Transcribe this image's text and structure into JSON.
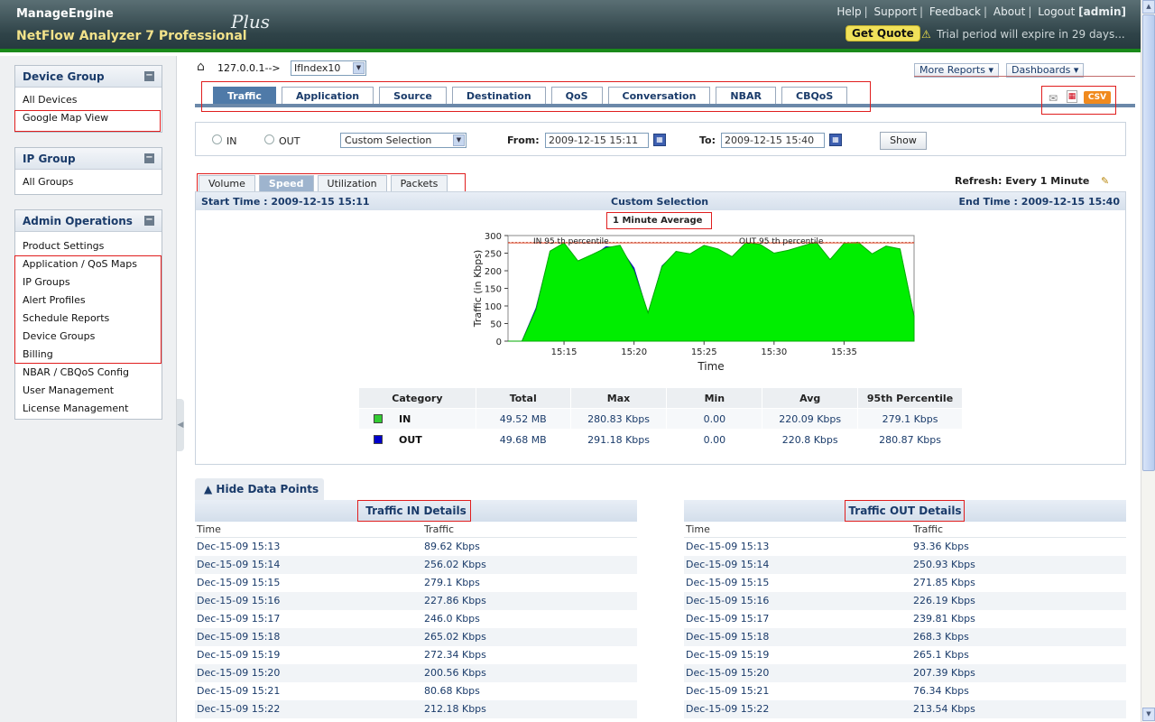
{
  "header": {
    "brand": "ManageEngine",
    "product": "NetFlow Analyzer 7 Professional",
    "edition": "Plus",
    "links": [
      "Help",
      "Support",
      "Feedback",
      "About",
      "Logout"
    ],
    "user": "[admin]",
    "get_quote": "Get Quote",
    "trial_text": "Trial period will expire in 29 days..."
  },
  "sidebar": {
    "device_group": {
      "title": "Device Group",
      "items": [
        "All Devices",
        "Google Map View"
      ]
    },
    "ip_group": {
      "title": "IP Group",
      "items": [
        "All Groups"
      ]
    },
    "admin": {
      "title": "Admin Operations",
      "items": [
        "Product Settings",
        "Application / QoS Maps",
        "IP Groups",
        "Alert Profiles",
        "Schedule Reports",
        "Device Groups",
        "Billing",
        "NBAR / CBQoS Config",
        "User Management",
        "License Management"
      ]
    }
  },
  "breadcrumb": {
    "device": "127.0.0.1-->",
    "interface": "IfIndex10"
  },
  "top_buttons": {
    "more_reports": "More Reports",
    "dashboards": "Dashboards"
  },
  "tabs": [
    "Traffic",
    "Application",
    "Source",
    "Destination",
    "QoS",
    "Conversation",
    "NBAR",
    "CBQoS"
  ],
  "active_tab": "Traffic",
  "filter": {
    "in_label": "IN",
    "out_label": "OUT",
    "range": "Custom Selection",
    "from_label": "From:",
    "from_value": "2009-12-15 15:11",
    "to_label": "To:",
    "to_value": "2009-12-15 15:40",
    "show": "Show"
  },
  "sub_tabs": [
    "Volume",
    "Speed",
    "Utilization",
    "Packets"
  ],
  "active_sub_tab": "Speed",
  "refresh": "Refresh: Every 1 Minute",
  "chart_header": {
    "start": "Start Time : 2009-12-15 15:11",
    "title": "Custom Selection",
    "end": "End Time : 2009-12-15 15:40",
    "average": "1 Minute Average"
  },
  "chart_data": {
    "type": "area",
    "xlabel": "Time",
    "ylabel": "Traffic (in Kbps)",
    "ylim": [
      0,
      300
    ],
    "yticks": [
      0,
      50,
      100,
      150,
      200,
      250,
      300
    ],
    "xticks": [
      "15:15",
      "15:20",
      "15:25",
      "15:30",
      "15:35"
    ],
    "annotations": [
      "IN 95 th percentile",
      "OUT 95 th percentile"
    ],
    "percentile_in": 279.1,
    "percentile_out": 280.87,
    "x": [
      "15:11",
      "15:12",
      "15:13",
      "15:14",
      "15:15",
      "15:16",
      "15:17",
      "15:18",
      "15:19",
      "15:20",
      "15:21",
      "15:22",
      "15:23",
      "15:24",
      "15:25",
      "15:26",
      "15:27",
      "15:28",
      "15:29",
      "15:30",
      "15:31",
      "15:32",
      "15:33",
      "15:34",
      "15:35",
      "15:36",
      "15:37",
      "15:38",
      "15:39",
      "15:40"
    ],
    "series": [
      {
        "name": "IN",
        "color": "#00ee00",
        "values": [
          0,
          0,
          89.62,
          256.02,
          279.1,
          227.86,
          246.0,
          265.02,
          272.34,
          200.56,
          80.68,
          212.18,
          255,
          248,
          272,
          262,
          240,
          280,
          275,
          250,
          258,
          270,
          282,
          232,
          278,
          281,
          248,
          270,
          262,
          70
        ]
      },
      {
        "name": "OUT",
        "color": "#0000cc",
        "values": [
          0,
          0,
          93.36,
          250.93,
          271.85,
          226.19,
          239.81,
          268.3,
          265.1,
          207.39,
          76.34,
          213.54,
          252,
          245,
          270,
          258,
          236,
          278,
          270,
          246,
          255,
          268,
          280,
          230,
          276,
          279,
          245,
          268,
          258,
          68
        ]
      }
    ]
  },
  "stats": {
    "headers": [
      "Category",
      "Total",
      "Max",
      "Min",
      "Avg",
      "95th Percentile"
    ],
    "rows": [
      {
        "category": "IN",
        "color": "#33cc33",
        "total": "49.52 MB",
        "max": "280.83 Kbps",
        "min": "0.00",
        "avg": "220.09 Kbps",
        "p95": "279.1 Kbps"
      },
      {
        "category": "OUT",
        "color": "#0000cc",
        "total": "49.68 MB",
        "max": "291.18 Kbps",
        "min": "0.00",
        "avg": "220.8 Kbps",
        "p95": "280.87 Kbps"
      }
    ]
  },
  "data_points": {
    "hide_label": "Hide Data Points",
    "in_title": "Traffic IN Details",
    "out_title": "Traffic OUT Details",
    "col_time": "Time",
    "col_traffic": "Traffic",
    "in_rows": [
      [
        "Dec-15-09 15:13",
        "89.62 Kbps"
      ],
      [
        "Dec-15-09 15:14",
        "256.02 Kbps"
      ],
      [
        "Dec-15-09 15:15",
        "279.1 Kbps"
      ],
      [
        "Dec-15-09 15:16",
        "227.86 Kbps"
      ],
      [
        "Dec-15-09 15:17",
        "246.0 Kbps"
      ],
      [
        "Dec-15-09 15:18",
        "265.02 Kbps"
      ],
      [
        "Dec-15-09 15:19",
        "272.34 Kbps"
      ],
      [
        "Dec-15-09 15:20",
        "200.56 Kbps"
      ],
      [
        "Dec-15-09 15:21",
        "80.68 Kbps"
      ],
      [
        "Dec-15-09 15:22",
        "212.18 Kbps"
      ]
    ],
    "out_rows": [
      [
        "Dec-15-09 15:13",
        "93.36 Kbps"
      ],
      [
        "Dec-15-09 15:14",
        "250.93 Kbps"
      ],
      [
        "Dec-15-09 15:15",
        "271.85 Kbps"
      ],
      [
        "Dec-15-09 15:16",
        "226.19 Kbps"
      ],
      [
        "Dec-15-09 15:17",
        "239.81 Kbps"
      ],
      [
        "Dec-15-09 15:18",
        "268.3 Kbps"
      ],
      [
        "Dec-15-09 15:19",
        "265.1 Kbps"
      ],
      [
        "Dec-15-09 15:20",
        "207.39 Kbps"
      ],
      [
        "Dec-15-09 15:21",
        "76.34 Kbps"
      ],
      [
        "Dec-15-09 15:22",
        "213.54 Kbps"
      ]
    ]
  }
}
